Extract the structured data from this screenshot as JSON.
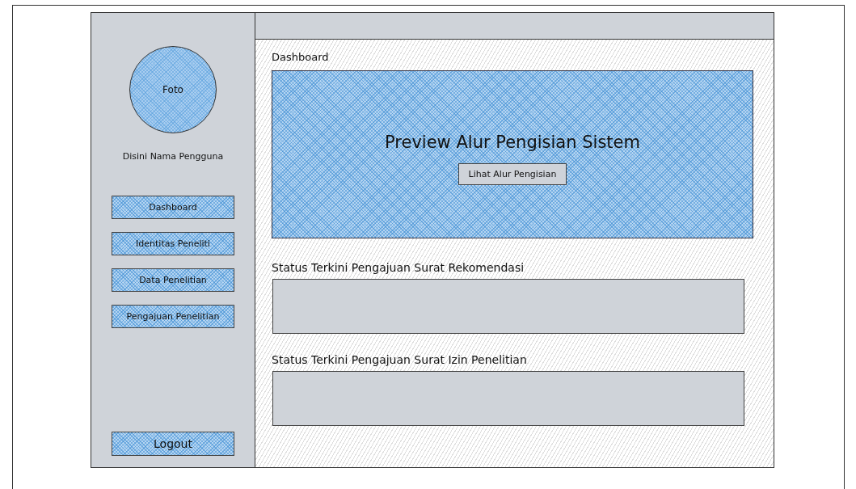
{
  "sidebar": {
    "photo": {
      "label": "Foto"
    },
    "user_name": "Disini Nama Pengguna",
    "nav_items": [
      {
        "label": "Dashboard"
      },
      {
        "label": "Identitas Peneliti"
      },
      {
        "label": "Data Penelitian"
      },
      {
        "label": "Pengajuan Penelitian"
      }
    ],
    "logout": "Logout"
  },
  "main": {
    "title": "Dashboard",
    "preview": {
      "title": "Preview Alur Pengisian Sistem",
      "button": "Lihat Alur Pengisian"
    },
    "status_sections": [
      {
        "title": "Status Terkini Pengajuan Surat Rekomendasi"
      },
      {
        "title": "Status Terkini Pengajuan Surat Izin Penelitian"
      }
    ]
  }
}
